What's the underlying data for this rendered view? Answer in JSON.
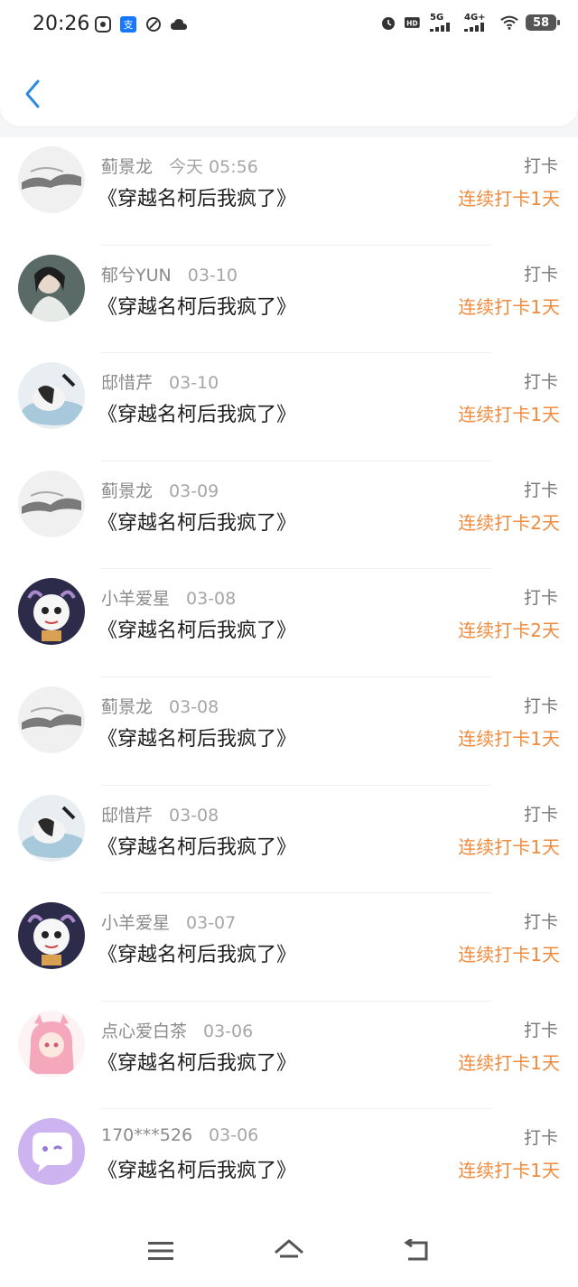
{
  "status_bar": {
    "time": "20:26",
    "hd_label": "HD",
    "net_5g": "5G",
    "net_4g": "4G+",
    "battery": "58"
  },
  "header": {
    "back_icon": "chevron-left-icon"
  },
  "colors": {
    "accent": "#2b8ae8",
    "streak": "#f08a3c"
  },
  "list": {
    "items": [
      {
        "user": "蓟景龙",
        "date": "今天 05:56",
        "book": "《穿越名柯后我疯了》",
        "tag": "打卡",
        "streak": "连续打卡1天"
      },
      {
        "user": "郁兮YUN",
        "date": "03-10",
        "book": "《穿越名柯后我疯了》",
        "tag": "打卡",
        "streak": "连续打卡1天"
      },
      {
        "user": "邸惜芹",
        "date": "03-10",
        "book": "《穿越名柯后我疯了》",
        "tag": "打卡",
        "streak": "连续打卡1天"
      },
      {
        "user": "蓟景龙",
        "date": "03-09",
        "book": "《穿越名柯后我疯了》",
        "tag": "打卡",
        "streak": "连续打卡2天"
      },
      {
        "user": "小羊爱星",
        "date": "03-08",
        "book": "《穿越名柯后我疯了》",
        "tag": "打卡",
        "streak": "连续打卡2天"
      },
      {
        "user": "蓟景龙",
        "date": "03-08",
        "book": "《穿越名柯后我疯了》",
        "tag": "打卡",
        "streak": "连续打卡1天"
      },
      {
        "user": "邸惜芹",
        "date": "03-08",
        "book": "《穿越名柯后我疯了》",
        "tag": "打卡",
        "streak": "连续打卡1天"
      },
      {
        "user": "小羊爱星",
        "date": "03-07",
        "book": "《穿越名柯后我疯了》",
        "tag": "打卡",
        "streak": "连续打卡1天"
      },
      {
        "user": "点心爱白茶",
        "date": "03-06",
        "book": "《穿越名柯后我疯了》",
        "tag": "打卡",
        "streak": "连续打卡1天"
      },
      {
        "user": "170***526",
        "date": "03-06",
        "book": "《穿越名柯后我疯了》",
        "tag": "打卡",
        "streak": "连续打卡1天"
      }
    ]
  },
  "nav": {
    "icons": [
      "menu-icon",
      "home-icon",
      "back-icon"
    ]
  }
}
